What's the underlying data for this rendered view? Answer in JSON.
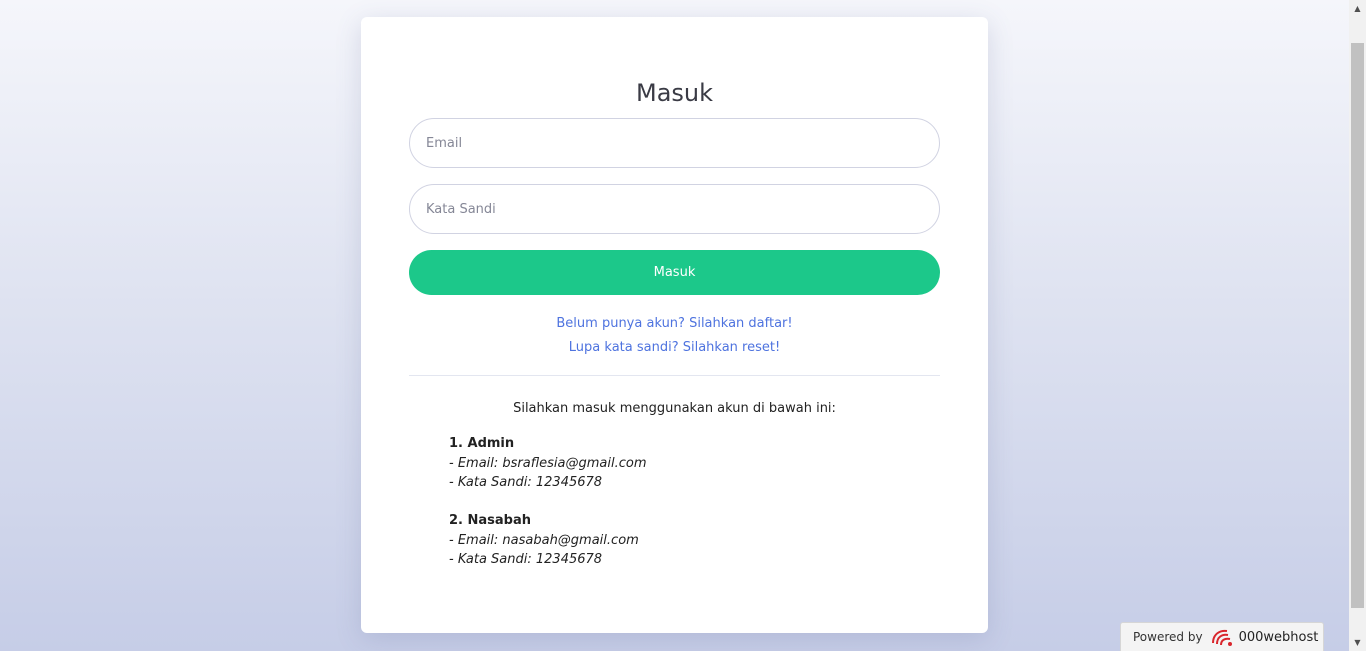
{
  "login": {
    "title": "Masuk",
    "email_placeholder": "Email",
    "password_placeholder": "Kata Sandi",
    "submit_label": "Masuk",
    "register_link": "Belum punya akun? Silahkan daftar!",
    "reset_link": "Lupa kata sandi? Silahkan reset!"
  },
  "info": {
    "heading": "Silahkan masuk menggunakan akun di bawah ini:",
    "accounts": [
      {
        "title": "1. Admin",
        "email_line": "- Email: bsraflesia@gmail.com",
        "password_line": "- Kata Sandi: 12345678"
      },
      {
        "title": "2. Nasabah",
        "email_line": "- Email: nasabah@gmail.com",
        "password_line": "- Kata Sandi: 12345678"
      }
    ]
  },
  "footer": {
    "powered_by": "Powered by",
    "brand": "000webhost",
    "logo_icon": "000webhost-logo-icon"
  },
  "colors": {
    "accent_green": "#1cc88a",
    "link_blue": "#4e73df",
    "logo_red": "#d9262c"
  }
}
